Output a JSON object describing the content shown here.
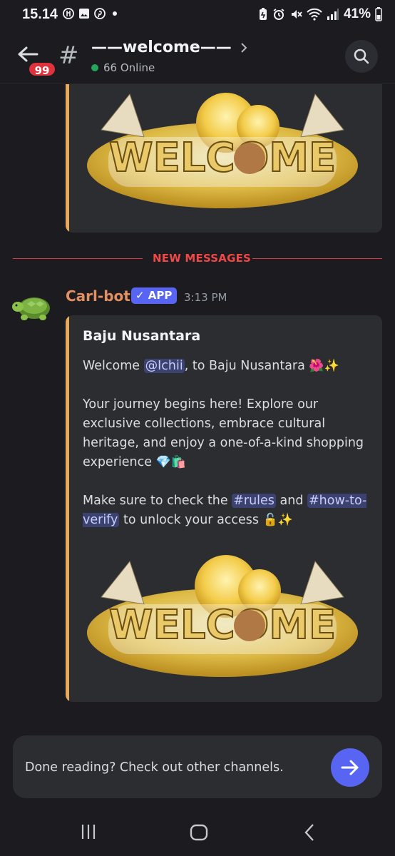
{
  "status_bar": {
    "time": "15.14",
    "battery": "41%"
  },
  "header": {
    "unread_badge": "99",
    "channel_name": "——welcome——",
    "online": "66 Online"
  },
  "divider": {
    "label": "NEW MESSAGES"
  },
  "message": {
    "author": "Carl-bot",
    "app_tag": "✓ APP",
    "timestamp": "3:13 PM",
    "embed": {
      "title": "Baju Nusantara",
      "line1_prefix": "Welcome ",
      "mention_user": "@Ichii",
      "line1_suffix": ", to Baju Nusantara ",
      "line1_emoji": "🌺✨",
      "para2": "Your journey begins here! Explore our exclusive collections, embrace cultural heritage, and enjoy a one-of-a-kind shopping experience ",
      "para2_emoji": "💎🛍️",
      "para3_prefix": "Make sure to check the ",
      "mention_rules": "#rules",
      "para3_mid": " and ",
      "mention_verify": "#how-to-verify",
      "para3_suffix": " to unlock your access ",
      "para3_emoji": "🔓✨",
      "image_text": "WELCOME"
    }
  },
  "input": {
    "placeholder": "Done reading? Check out other channels."
  },
  "colors": {
    "accent": "#5865f2",
    "embed_bar": "#e8a95c",
    "new_messages": "#f04747",
    "author": "#e28f61",
    "online": "#23a55a"
  }
}
